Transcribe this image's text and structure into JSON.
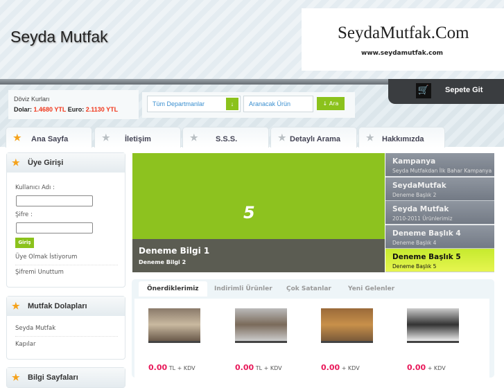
{
  "header": {
    "logo": "Seyda Mutfak",
    "brand": "SeydaMutfak.Com",
    "brand_url": "www.seydamutfak.com",
    "cart": "Sepete Git"
  },
  "currency": {
    "title": "Döviz Kurları",
    "dollar_label": "Dolar:",
    "dollar": "1.4680 YTL",
    "euro_label": "Euro:",
    "euro": "2.1130 YTL"
  },
  "search": {
    "department": "Tüm Departmanlar",
    "placeholder": "Aranacak Ürün",
    "button": "Ara"
  },
  "nav": [
    "Ana Sayfa",
    "İletişim",
    "S.S.S.",
    "Detaylı Arama",
    "Hakkımızda"
  ],
  "login": {
    "title": "Üye Girişi",
    "username": "Kullanıcı Adı :",
    "password": "Şifre :",
    "submit": "Giriş",
    "register": "Üye Olmak İstiyorum",
    "forgot": "Şifremi Unuttum"
  },
  "cabinets": {
    "title": "Mutfak Dolapları",
    "items": [
      "Seyda Mutfak",
      "Kapılar"
    ]
  },
  "info": {
    "title": "Bilgi Sayfaları"
  },
  "slider": {
    "number": "5",
    "caption_title": "Deneme Bilgi 1",
    "caption_sub": "Deneme Bilgi 2",
    "items": [
      {
        "t": "Kampanya",
        "s": "Seyda Mutfakdan İlk Bahar Kampanya"
      },
      {
        "t": "SeydaMutfak",
        "s": "Deneme Başlık 2"
      },
      {
        "t": "Seyda Mutfak",
        "s": "2010-2011 Ürünlerimiz"
      },
      {
        "t": "Deneme Başlık 4",
        "s": "Deneme Başlık 4"
      },
      {
        "t": "Deneme Başlık 5",
        "s": "Deneme Başlık 5"
      }
    ]
  },
  "products": {
    "tabs": [
      "Önerdiklerimiz",
      "Indirimli Ürünler",
      "Çok Satanlar",
      "Yeni Gelenler"
    ],
    "items": [
      {
        "price": "0.00",
        "unit": "TL + KDV"
      },
      {
        "price": "0.00",
        "unit": "TL + KDV"
      },
      {
        "price": "0.00",
        "unit": "+ KDV"
      },
      {
        "price": "0.00",
        "unit": "+ KDV"
      }
    ]
  }
}
